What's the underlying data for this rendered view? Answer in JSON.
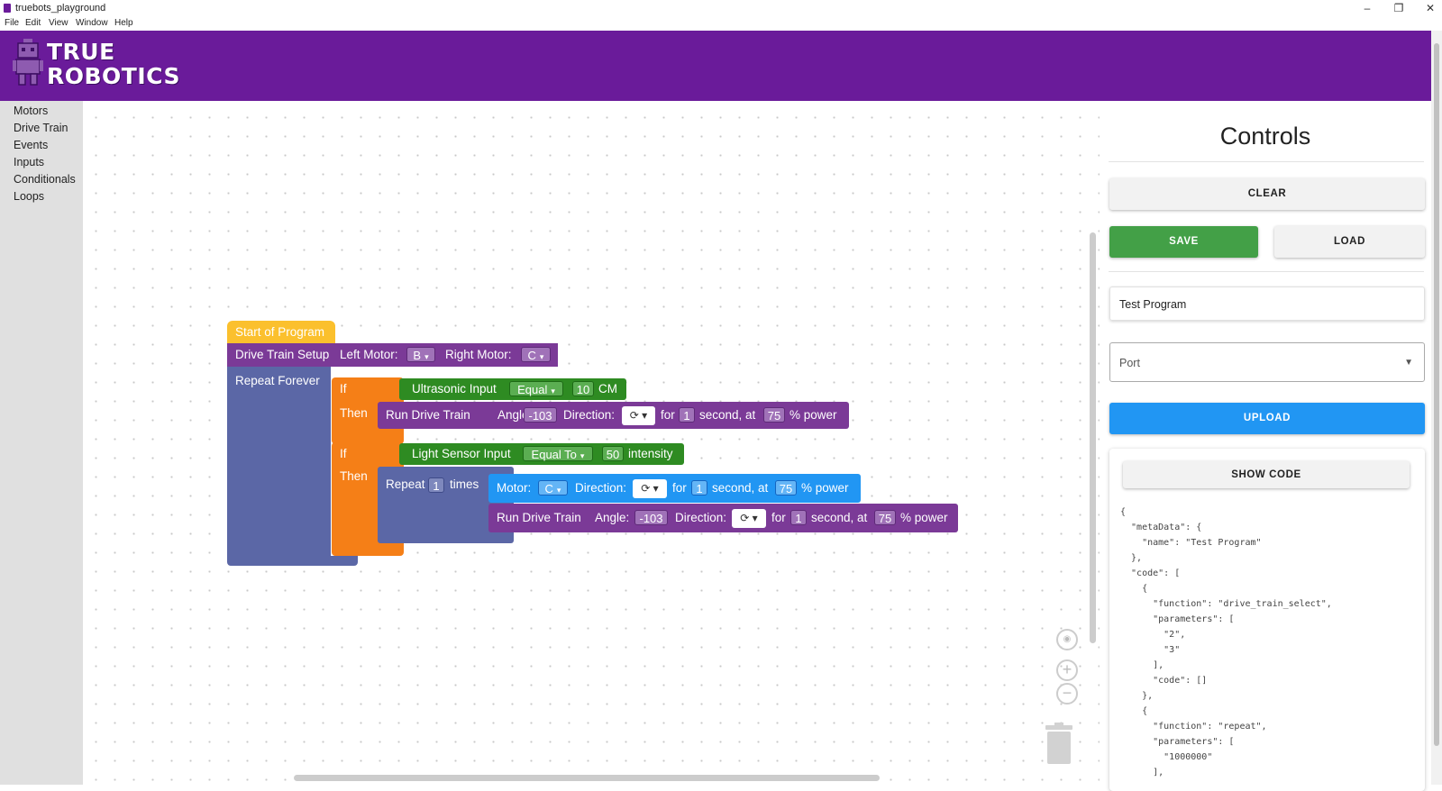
{
  "window": {
    "title": "truebots_playground",
    "minimize": "–",
    "restore": "❐",
    "close": "✕"
  },
  "menu": [
    "File",
    "Edit",
    "View",
    "Window",
    "Help"
  ],
  "logo": {
    "line1": "TRUE",
    "line2": "ROBOTICS"
  },
  "categories": [
    "Motors",
    "Drive Train",
    "Events",
    "Inputs",
    "Conditionals",
    "Loops"
  ],
  "blocks": {
    "start": "Start of Program",
    "drive_setup": {
      "label": "Drive Train Setup",
      "left_label": "Left Motor:",
      "left_value": "B",
      "right_label": "Right Motor:",
      "right_value": "C"
    },
    "repeat_forever": "Repeat Forever",
    "if1": {
      "if_label": "If",
      "then_label": "Then",
      "cond": {
        "label": "Ultrasonic Input",
        "op": "Equal",
        "value": "10",
        "unit": "CM"
      },
      "action": {
        "label": "Run Drive Train",
        "angle_label": "Angle:",
        "angle": "-103",
        "dir_label": "Direction:",
        "for_label": "for",
        "seconds": "1",
        "sec_label": "second, at",
        "power": "75",
        "power_label": "% power"
      }
    },
    "if2": {
      "if_label": "If",
      "then_label": "Then",
      "cond": {
        "label": "Light Sensor Input",
        "op": "Equal To",
        "value": "50",
        "unit": "intensity"
      },
      "repeat": {
        "label": "Repeat",
        "count": "1",
        "times": "times"
      },
      "motor": {
        "label": "Motor:",
        "value": "C",
        "dir_label": "Direction:",
        "for_label": "for",
        "seconds": "1",
        "sec_label": "second, at",
        "power": "75",
        "power_label": "% power"
      },
      "action": {
        "label": "Run Drive Train",
        "angle_label": "Angle:",
        "angle": "-103",
        "dir_label": "Direction:",
        "for_label": "for",
        "seconds": "1",
        "sec_label": "second, at",
        "power": "75",
        "power_label": "% power"
      }
    }
  },
  "controls": {
    "title": "Controls",
    "clear": "CLEAR",
    "save": "SAVE",
    "load": "LOAD",
    "program_name": "Test Program",
    "port_placeholder": "Port",
    "upload": "UPLOAD",
    "show_code": "SHOW CODE",
    "code_text": "{\n  \"metaData\": {\n    \"name\": \"Test Program\"\n  },\n  \"code\": [\n    {\n      \"function\": \"drive_train_select\",\n      \"parameters\": [\n        \"2\",\n        \"3\"\n      ],\n      \"code\": []\n    },\n    {\n      \"function\": \"repeat\",\n      \"parameters\": [\n        \"1000000\"\n      ],"
  },
  "colors": {
    "header": "#6a1b9a",
    "save": "#43a047",
    "upload": "#2196f3"
  }
}
